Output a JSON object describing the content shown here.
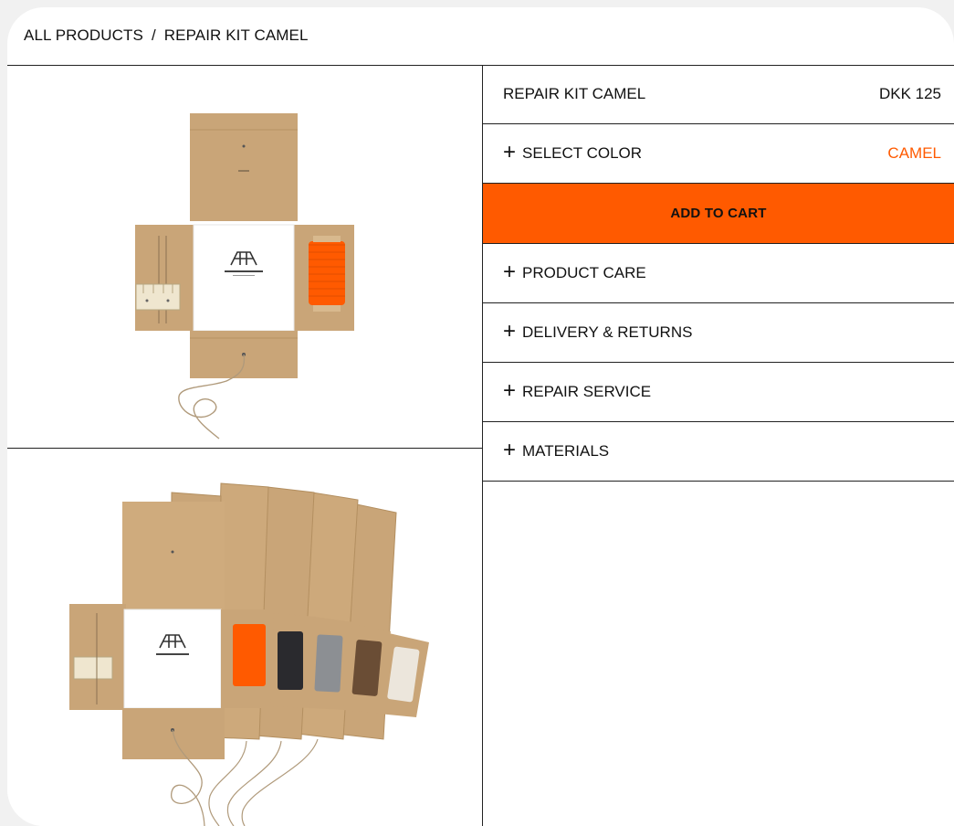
{
  "breadcrumb": {
    "root": "ALL PRODUCTS",
    "separator": "/",
    "current": "REPAIR KIT CAMEL"
  },
  "product": {
    "name": "REPAIR KIT CAMEL",
    "price": "DKK 125"
  },
  "color_selector": {
    "label": "SELECT COLOR",
    "value": "CAMEL"
  },
  "cart": {
    "button_label": "ADD TO CART"
  },
  "accordion": [
    {
      "label": "PRODUCT CARE"
    },
    {
      "label": "DELIVERY & RETURNS"
    },
    {
      "label": "REPAIR SERVICE"
    },
    {
      "label": "MATERIALS"
    }
  ],
  "icons": {
    "expand": "plus-icon",
    "plus_glyph": "+"
  },
  "colors": {
    "accent": "#ff5a00",
    "cardboard": "#c9a578",
    "text": "#111111",
    "border": "#222222",
    "background": "#f1f1f1"
  }
}
